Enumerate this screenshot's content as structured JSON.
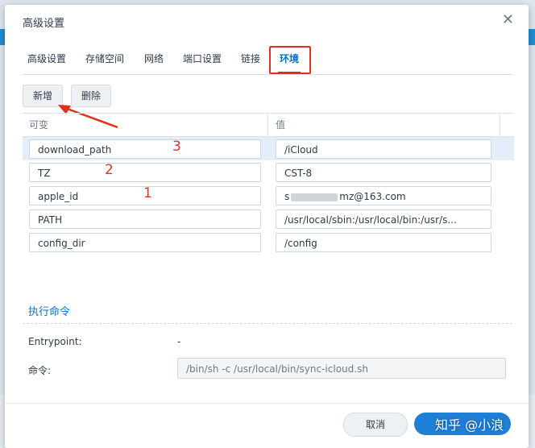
{
  "dialog": {
    "title": "高级设置"
  },
  "tabs": [
    {
      "label": "高级设置"
    },
    {
      "label": "存储空间"
    },
    {
      "label": "网络"
    },
    {
      "label": "端口设置"
    },
    {
      "label": "链接"
    },
    {
      "label": "环境",
      "active": true
    }
  ],
  "toolbar": {
    "add_label": "新增",
    "delete_label": "删除"
  },
  "table": {
    "columns": [
      "可变",
      "值"
    ],
    "rows": [
      {
        "key": "download_path",
        "value": "/iCloud"
      },
      {
        "key": "TZ",
        "value": "CST-8"
      },
      {
        "key": "apple_id",
        "value_prefix": "s",
        "value_suffix": "mz@163.com"
      },
      {
        "key": "PATH",
        "value": "/usr/local/sbin:/usr/local/bin:/usr/s..."
      },
      {
        "key": "config_dir",
        "value": "/config"
      }
    ]
  },
  "annotations": {
    "mark_row1": "3",
    "mark_row2": "2",
    "mark_row3": "1"
  },
  "exec": {
    "section_title": "执行命令",
    "entrypoint_label": "Entrypoint:",
    "entrypoint_value": "-",
    "command_label": "命令:",
    "command_value": "/bin/sh -c /usr/local/bin/sync-icloud.sh"
  },
  "footer": {
    "cancel_label": "取消"
  },
  "watermark": "知乎 @小浪",
  "colors": {
    "accent": "#0a6fc2",
    "annotation_red": "#e0301e",
    "apply_blue": "#1e7fd6",
    "selected_row": "#e2eefa"
  },
  "icons": {
    "close": "close-icon"
  }
}
